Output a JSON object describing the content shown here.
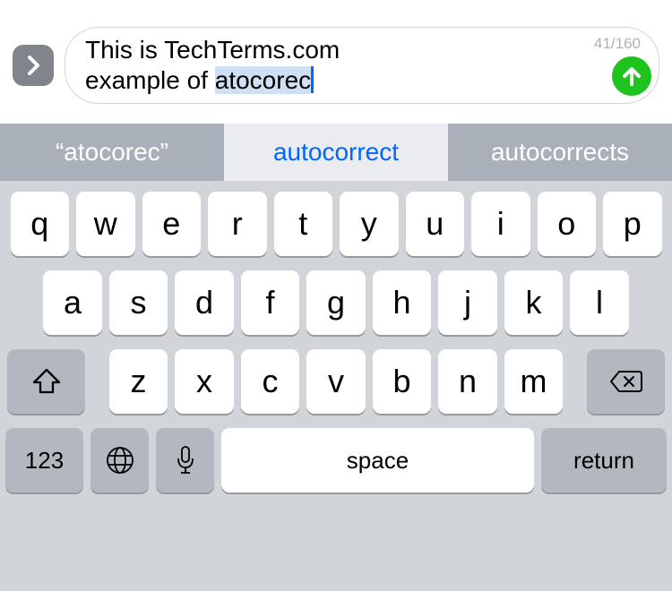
{
  "compose": {
    "text_prefix": "This is TechTerms.com\nexample of ",
    "highlighted_word": "atocorec",
    "char_count": "41/160"
  },
  "suggestions": {
    "items": [
      {
        "label": "“atocorec”",
        "selected": false
      },
      {
        "label": "autocorrect",
        "selected": true
      },
      {
        "label": "autocorrects",
        "selected": false
      }
    ]
  },
  "keyboard": {
    "row1": [
      "q",
      "w",
      "e",
      "r",
      "t",
      "y",
      "u",
      "i",
      "o",
      "p"
    ],
    "row2": [
      "a",
      "s",
      "d",
      "f",
      "g",
      "h",
      "j",
      "k",
      "l"
    ],
    "row3": [
      "z",
      "x",
      "c",
      "v",
      "b",
      "n",
      "m"
    ],
    "numbers_label": "123",
    "space_label": "space",
    "return_label": "return"
  }
}
